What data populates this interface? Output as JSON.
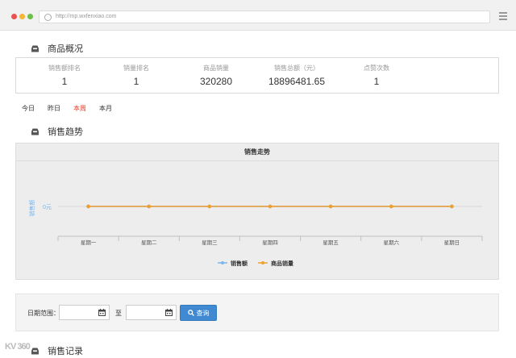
{
  "browser": {
    "url": "http://mp.wxfenxiao.com"
  },
  "overview": {
    "title": "商品概况",
    "stats": [
      {
        "label": "销售额排名",
        "value": "1"
      },
      {
        "label": "销量排名",
        "value": "1"
      },
      {
        "label": "商品销量",
        "value": "320280"
      },
      {
        "label": "销售总额（元）",
        "value": "18896481.65"
      },
      {
        "label": "点赞次数",
        "value": "1"
      }
    ]
  },
  "tabs": [
    {
      "label": "今日",
      "active": false
    },
    {
      "label": "昨日",
      "active": false
    },
    {
      "label": "本周",
      "active": true
    },
    {
      "label": "本月",
      "active": false
    }
  ],
  "trend": {
    "title": "销售趋势"
  },
  "chart_data": {
    "type": "line",
    "title": "销售走势",
    "ylabel": "销售额",
    "y_tick": "0元",
    "categories": [
      "星期一",
      "星期二",
      "星期三",
      "星期四",
      "星期五",
      "星期六",
      "星期日"
    ],
    "series": [
      {
        "name": "销售额",
        "color": "#7cb5ec",
        "values": [
          0,
          0,
          0,
          0,
          0,
          0,
          0
        ]
      },
      {
        "name": "商品销量",
        "color": "#f0a030",
        "values": [
          0,
          0,
          0,
          0,
          0,
          0,
          0
        ]
      }
    ],
    "legend_position": "bottom",
    "grid": false
  },
  "filter": {
    "date_label": "日期范围：",
    "start_value": "",
    "to_label": "至",
    "end_value": "",
    "query_label": "查询"
  },
  "records": {
    "title": "销售记录"
  },
  "watermark": "KV 360"
}
